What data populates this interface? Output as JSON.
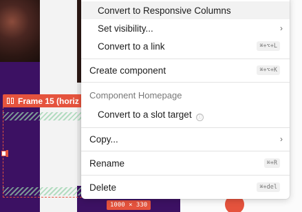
{
  "frame": {
    "label": "Frame 15 (horiz",
    "dimensions": "1000 × 330"
  },
  "menu": {
    "items": [
      {
        "label": "Convert to Responsive Columns"
      },
      {
        "label": "Set visibility...",
        "chevron": "›"
      },
      {
        "label": "Convert to a link",
        "shortcut": "⌘+⌥+L"
      },
      {
        "label": "Create component",
        "shortcut": "⌘+⌥+K"
      },
      {
        "label": "Convert to a slot target",
        "info": "ⓘ"
      },
      {
        "label": "Copy...",
        "chevron": "›"
      },
      {
        "label": "Rename",
        "shortcut": "⌘+R"
      },
      {
        "label": "Delete",
        "shortcut": "⌘+del"
      }
    ],
    "section_header": "Component Homepage"
  },
  "colors": {
    "accent": "#e5533d",
    "purple": "#3c1163"
  }
}
